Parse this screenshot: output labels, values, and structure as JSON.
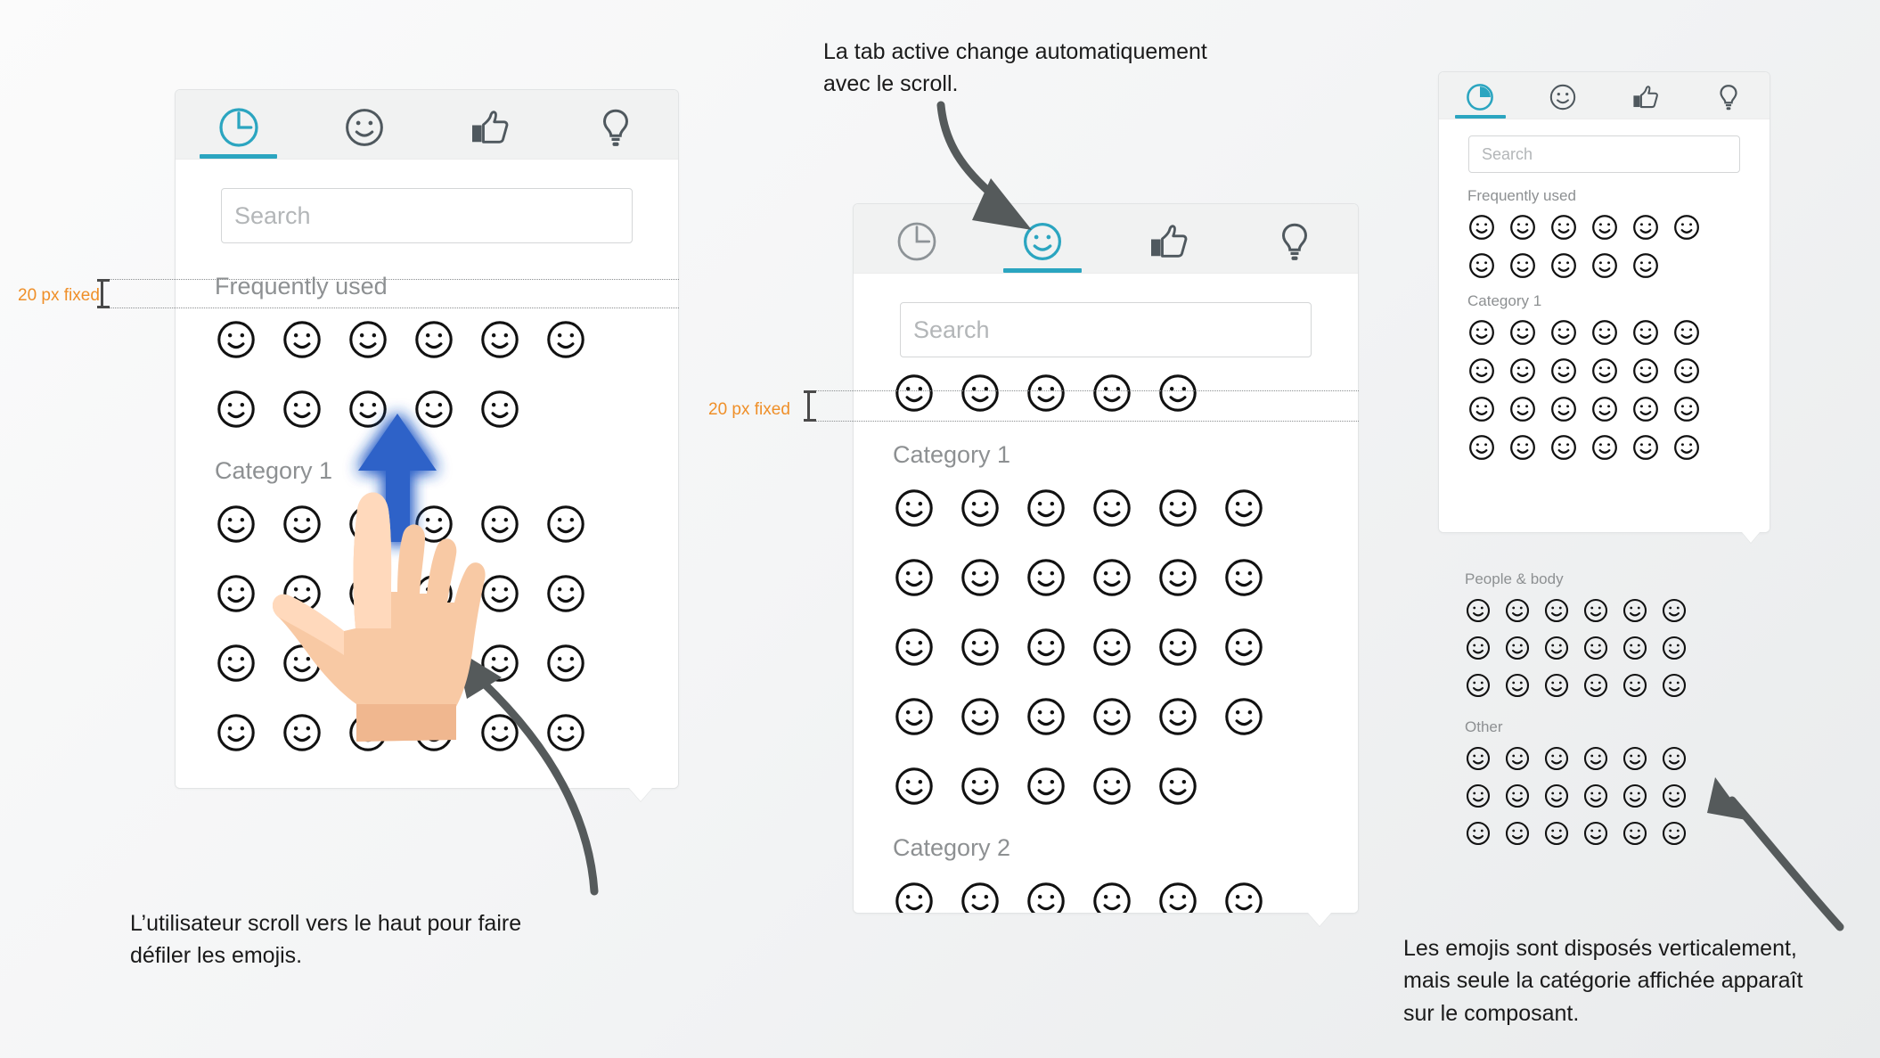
{
  "tabs": [
    {
      "id": "recent",
      "icon": "clock-icon",
      "label": "Recent"
    },
    {
      "id": "smileys",
      "icon": "smiley-icon",
      "label": "Smileys & emotion"
    },
    {
      "id": "likes",
      "icon": "thumbs-up-icon",
      "label": "Likes"
    },
    {
      "id": "ideas",
      "icon": "lightbulb-icon",
      "label": "Ideas"
    }
  ],
  "search": {
    "placeholder": "Search",
    "value": ""
  },
  "accent_color": "#2ba5c0",
  "measure_color": "#ef8f28",
  "panels": {
    "left": {
      "name": "panel-scroll-top",
      "active_tab": "recent",
      "search_placeholder": "Search",
      "sections": [
        {
          "label": "Frequently used",
          "counts": [
            6,
            5
          ]
        },
        {
          "label": "Category 1",
          "counts": [
            6,
            6,
            6,
            6
          ]
        }
      ]
    },
    "middle": {
      "name": "panel-scrolled",
      "active_tab": "smileys",
      "search_placeholder": "Search",
      "sections": [
        {
          "label": "",
          "counts": [
            5
          ]
        },
        {
          "label": "Category 1",
          "counts": [
            6,
            6,
            6,
            6,
            5
          ]
        },
        {
          "label": "Category 2",
          "counts": [
            6
          ]
        }
      ]
    },
    "right": {
      "name": "panel-vertical-overview",
      "active_tab": "recent",
      "search_placeholder": "Search",
      "sections": [
        {
          "label": "Frequently used",
          "counts": [
            6,
            5
          ]
        },
        {
          "label": "Category 1",
          "counts": [
            6,
            6,
            6,
            6
          ]
        }
      ],
      "overflow_sections": [
        {
          "label": "People & body",
          "counts": [
            6,
            6,
            6
          ]
        },
        {
          "label": "Other",
          "counts": [
            6,
            6,
            6
          ]
        }
      ]
    }
  },
  "measurements": [
    {
      "id": "left-fixed",
      "label": "20 px fixed"
    },
    {
      "id": "middle-fixed",
      "label": "20 px fixed"
    }
  ],
  "annotations": [
    {
      "id": "tab-auto",
      "text": "La tab active change automatiquement\navec le scroll."
    },
    {
      "id": "user-scroll",
      "text": "L’utilisateur scroll vers le haut pour faire\ndéfiler les emojis."
    },
    {
      "id": "vertical-layout",
      "text": "Les emojis sont disposés verticalement,\nmais seule la catégorie affichée apparaît\nsur le composant."
    }
  ]
}
